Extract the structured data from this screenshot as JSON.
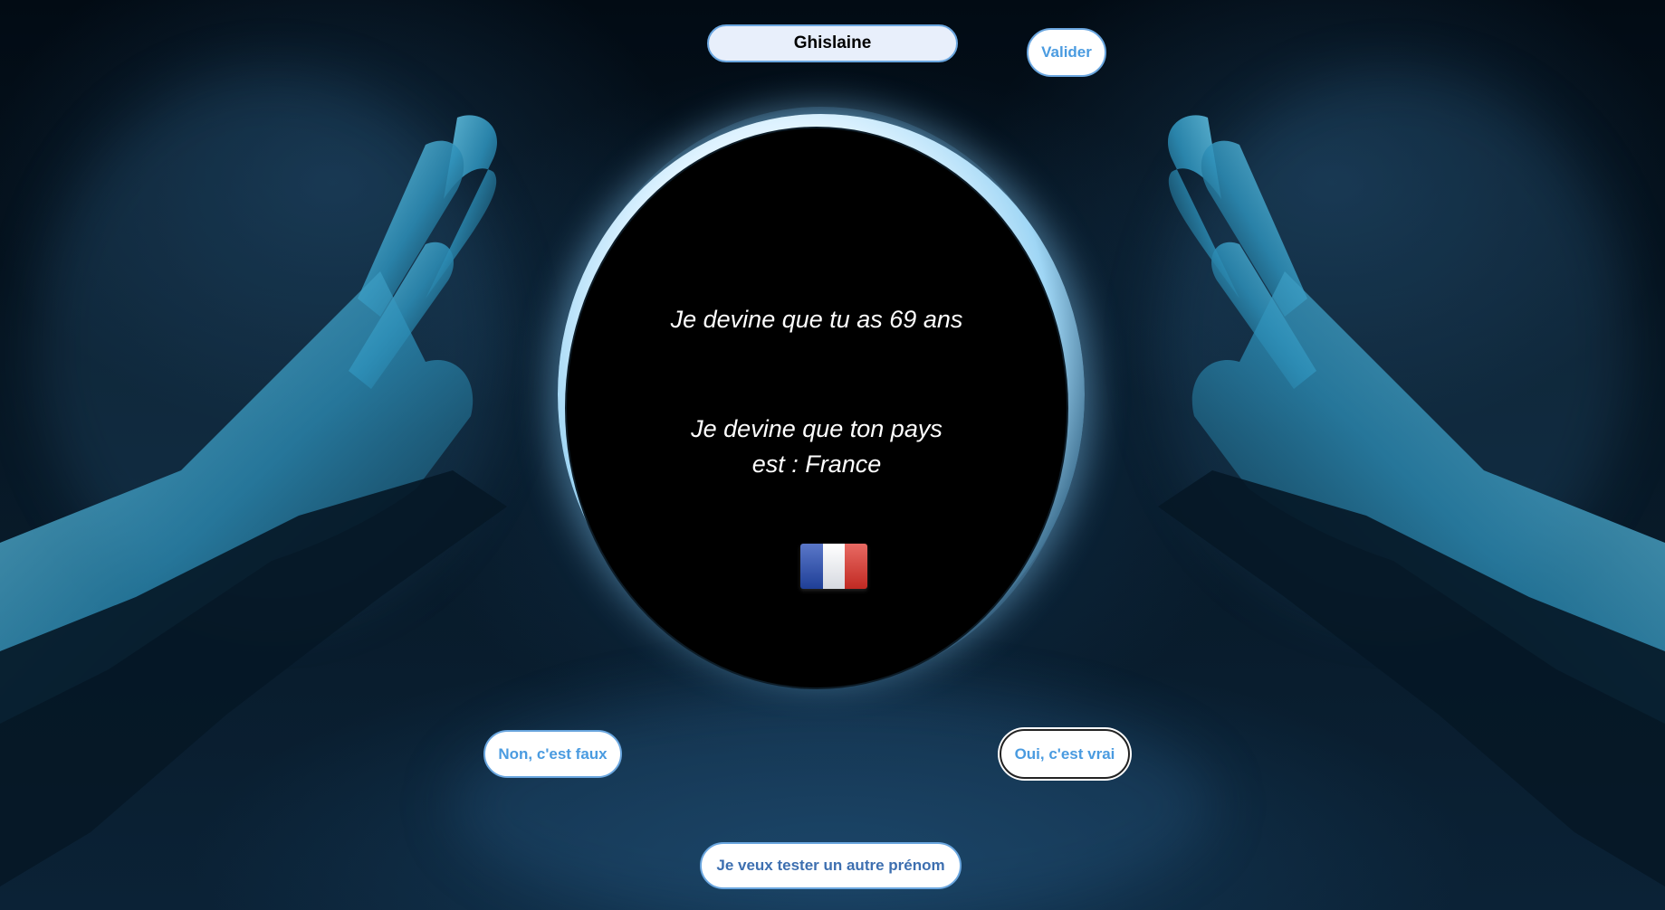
{
  "form": {
    "name_value": "Ghislaine",
    "submit_label": "Valider"
  },
  "result": {
    "age_text": "Je devine que tu as 69 ans",
    "country_line1": "Je devine que ton pays",
    "country_line2": "est : France",
    "flag_icon": "flag-france-icon",
    "flag_colors": [
      "#1f3f97",
      "#ffffff",
      "#c12a23"
    ]
  },
  "answers": {
    "no_label": "Non, c'est faux",
    "yes_label": "Oui, c'est vrai"
  },
  "footer": {
    "retry_label": "Je veux tester un autre prénom"
  },
  "theme": {
    "accent": "#4a9be0",
    "border": "#6aa6df",
    "background": "#071826"
  }
}
